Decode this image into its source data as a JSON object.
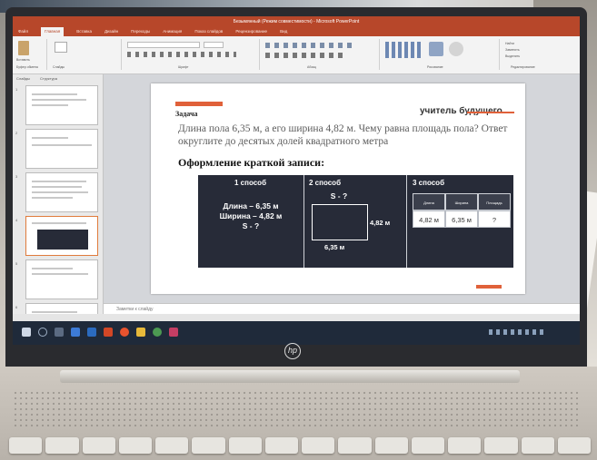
{
  "window": {
    "title": "Безымянный (Режим совместимости) - Microsoft PowerPoint",
    "tabs": [
      "Файл",
      "Главная",
      "Вставка",
      "Дизайн",
      "Переходы",
      "Анимация",
      "Показ слайдов",
      "Рецензирование",
      "Вид"
    ],
    "active_tab": "Главная"
  },
  "ribbon": {
    "paste_label": "Вставить",
    "groups": [
      "Буфер обмена",
      "Слайды",
      "Шрифт",
      "Абзац",
      "Рисование",
      "Редактирование"
    ],
    "find_label": "Найти",
    "replace_label": "Заменить",
    "select_label": "Выделить"
  },
  "panel": {
    "tabs": [
      "Слайды",
      "Структура"
    ],
    "thumbnail_numbers": [
      "1",
      "2",
      "3",
      "4",
      "5",
      "6"
    ],
    "selected_index": 4
  },
  "notes": {
    "placeholder": "Заметки к слайду"
  },
  "slide": {
    "label": "Задача",
    "brand": "учитель будущего",
    "problem": "Длина пола 6,35 м, а его ширина 4,82 м. Чему равна площадь пола? Ответ округлите до десятых долей квадратного метра",
    "subtitle": "Оформление краткой записи:",
    "method1": {
      "title": "1 способ",
      "line1": "Длина – 6,35 м",
      "line2": "Ширина – 4,82 м",
      "line3": "S - ?"
    },
    "method2": {
      "title": "2 способ",
      "area": "S - ?",
      "side_label": "4,82 м",
      "bottom_label": "6,35 м"
    },
    "method3": {
      "title": "3 способ",
      "headers": [
        "Длина",
        "Ширина",
        "Площадь"
      ],
      "values": [
        "4,82 м",
        "6,35 м",
        "?"
      ]
    }
  },
  "colors": {
    "accent": "#e0613a",
    "ppt_brand": "#b7472a",
    "slide_box": "#272b38",
    "taskbar": "#1f2a3a"
  },
  "laptop": {
    "logo": "hp"
  }
}
